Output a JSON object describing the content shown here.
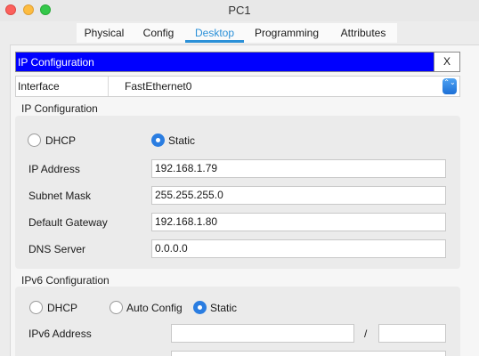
{
  "window": {
    "title": "PC1"
  },
  "tabs": [
    "Physical",
    "Config",
    "Desktop",
    "Programming",
    "Attributes"
  ],
  "active_tab": "Desktop",
  "panel": {
    "title": "IP Configuration",
    "close_label": "X"
  },
  "interface": {
    "label": "Interface",
    "value": "FastEthernet0",
    "select_glyph": "⌃⌄"
  },
  "ipv4": {
    "section_label": "IP Configuration",
    "dhcp_label": "DHCP",
    "static_label": "Static",
    "mode": "Static",
    "fields": [
      {
        "label": "IP Address",
        "value": "192.168.1.79"
      },
      {
        "label": "Subnet Mask",
        "value": "255.255.255.0"
      },
      {
        "label": "Default Gateway",
        "value": "192.168.1.80"
      },
      {
        "label": "DNS Server",
        "value": "0.0.0.0"
      }
    ]
  },
  "ipv6": {
    "section_label": "IPv6 Configuration",
    "dhcp_label": "DHCP",
    "auto_label": "Auto Config",
    "static_label": "Static",
    "mode": "Static",
    "address_label": "IPv6 Address",
    "address_value": "",
    "prefix_separator": "/",
    "prefix_value": ""
  },
  "colors": {
    "accent": "#2a90d8",
    "header_bg": "#0000ff",
    "radio_checked": "#2a7de1"
  }
}
